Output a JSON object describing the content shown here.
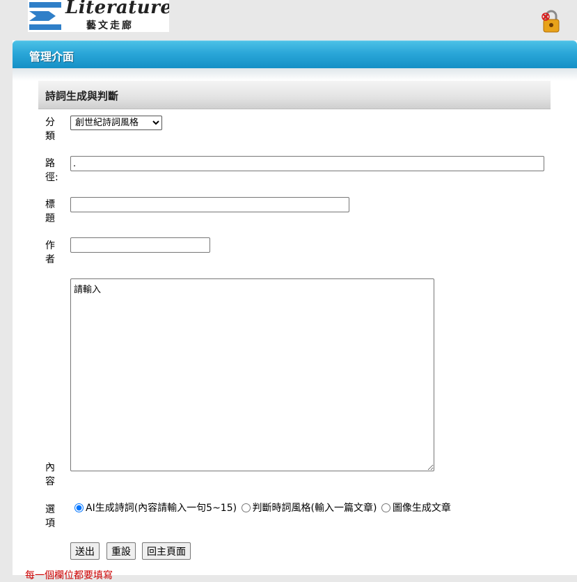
{
  "header": {
    "logo_title": "Literature",
    "logo_subtitle": "藝文走廊",
    "logout_icon": "lock-icon"
  },
  "panel": {
    "title": "管理介面",
    "section_title": "詩詞生成與判斷"
  },
  "form": {
    "category_label": "分類",
    "category_value": "創世紀詩詞風格",
    "path_label": "路徑:",
    "path_value": ".",
    "title_label": "標題",
    "title_value": "",
    "author_label": "作者",
    "author_value": "",
    "content_label": "內容",
    "content_value": "請輸入",
    "options_label": "選項",
    "options": [
      {
        "label": "AI生成詩詞(內容請輸入一句5~15)",
        "checked": true
      },
      {
        "label": "判斷時詞風格(輸入一篇文章)",
        "checked": false
      },
      {
        "label": "圖像生成文章",
        "checked": false
      }
    ],
    "submit_label": "送出",
    "reset_label": "重設",
    "home_label": "回主頁面",
    "notice": "每一個欄位都要填寫"
  },
  "colors": {
    "header_blue": "#2aa6d8",
    "notice_red": "#cc0000"
  }
}
